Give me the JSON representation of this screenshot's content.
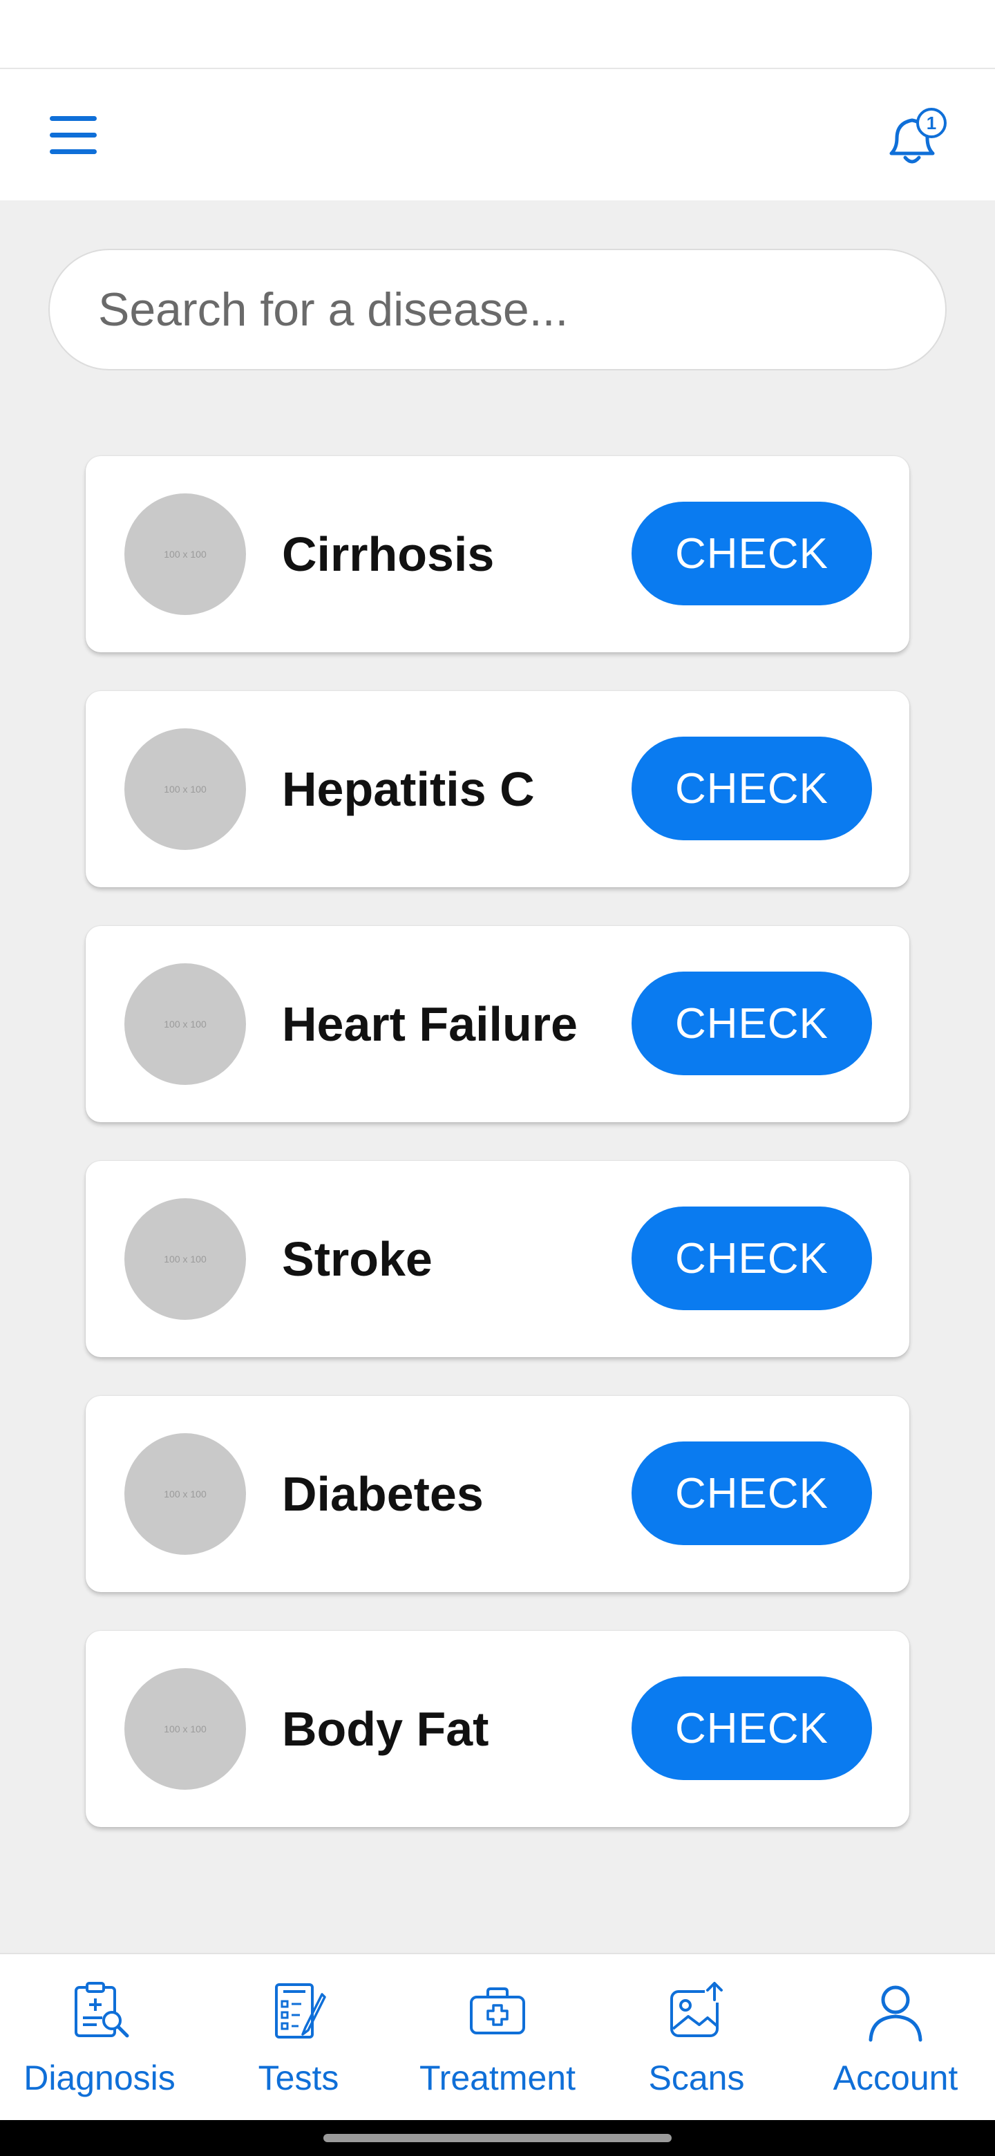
{
  "header": {
    "menu_icon": "hamburger-menu-icon",
    "notification_icon": "bell-icon",
    "notification_count": "1"
  },
  "search": {
    "placeholder": "Search for a disease..."
  },
  "diseases": [
    {
      "name": "Cirrhosis",
      "thumb": "100 x 100",
      "button": "CHECK"
    },
    {
      "name": "Hepatitis C",
      "thumb": "100 x 100",
      "button": "CHECK"
    },
    {
      "name": "Heart Failure",
      "thumb": "100 x 100",
      "button": "CHECK"
    },
    {
      "name": "Stroke",
      "thumb": "100 x 100",
      "button": "CHECK"
    },
    {
      "name": "Diabetes",
      "thumb": "100 x 100",
      "button": "CHECK"
    },
    {
      "name": "Body Fat",
      "thumb": "100 x 100",
      "button": "CHECK"
    }
  ],
  "bottom_nav": [
    {
      "label": "Diagnosis",
      "icon": "clipboard-search-icon"
    },
    {
      "label": "Tests",
      "icon": "test-checklist-icon"
    },
    {
      "label": "Treatment",
      "icon": "medical-kit-icon"
    },
    {
      "label": "Scans",
      "icon": "image-upload-icon"
    },
    {
      "label": "Account",
      "icon": "user-icon"
    }
  ],
  "colors": {
    "accent": "#0a7bf0",
    "icon_blue": "#0f6fd8",
    "background": "#efefef"
  }
}
